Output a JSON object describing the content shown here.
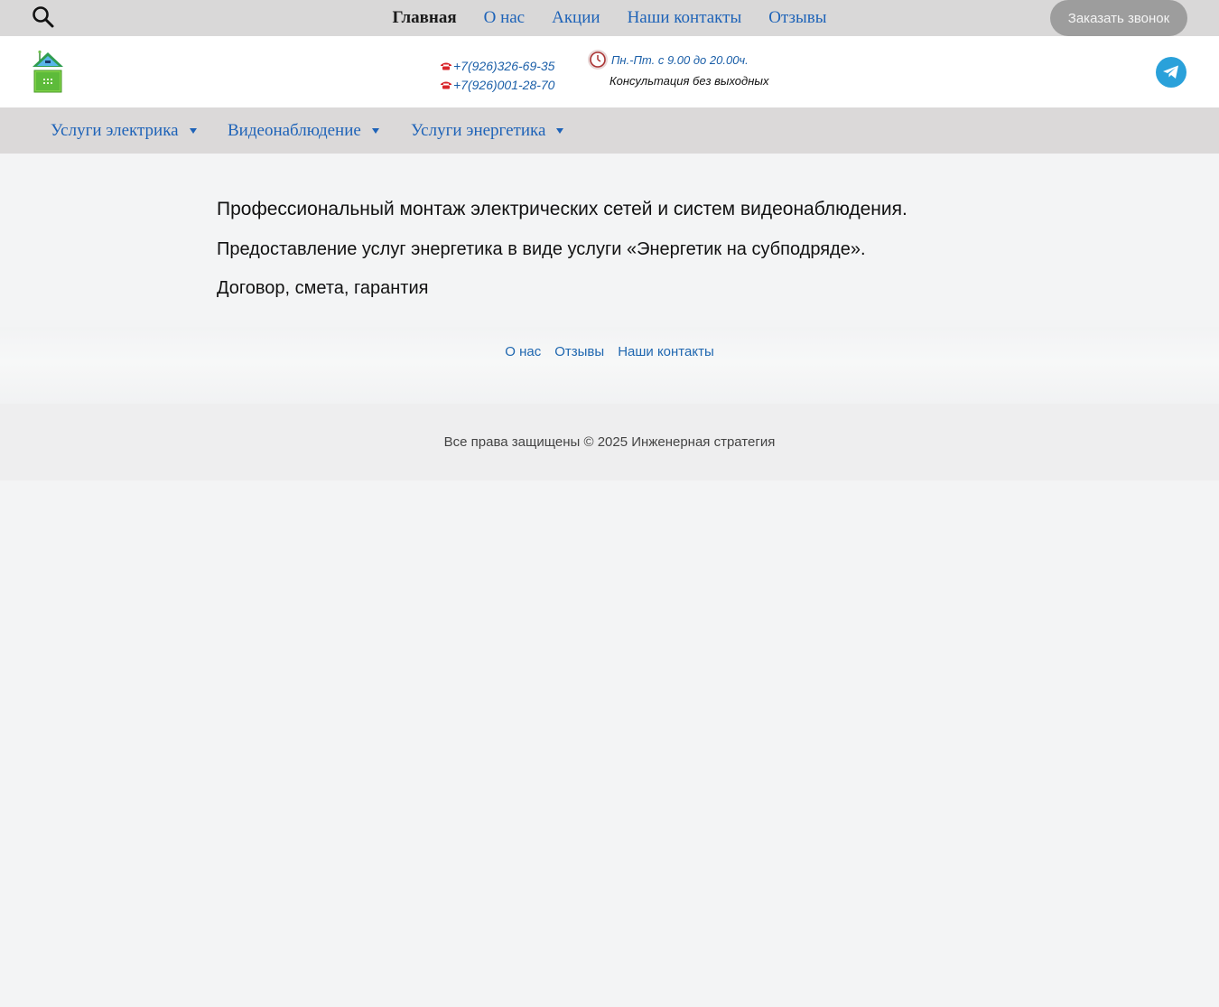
{
  "top_bar": {
    "nav": [
      "Главная",
      "О нас",
      "Акции",
      "Наши контакты",
      "Отзывы"
    ],
    "active_index": 0,
    "call_button_label": "Заказать звонок"
  },
  "header": {
    "phones": [
      "+7(926)326-69-35",
      "+7(926)001-28-70"
    ],
    "hours": "Пн.-Пт. с 9.00 до 20.00ч.",
    "consultation": "Консультация без выходных"
  },
  "services_nav": {
    "items": [
      "Услуги электрика",
      "Видеонаблюдение",
      "Услуги энергетика"
    ]
  },
  "main": {
    "paragraphs": [
      "Профессиональный монтаж электрических сетей и систем видеонаблюдения.",
      "Предоставление услуг энергетика в виде услуги «Энергетик на субподряде».",
      "Договор, смета, гарантия"
    ]
  },
  "footer": {
    "links": [
      "О нас",
      "Отзывы",
      "Наши контакты"
    ],
    "copyright": "Все права защищены © 2025 Инженерная стратегия"
  },
  "colors": {
    "link_blue": "#1e63b8",
    "telegram_blue": "#2aa1da",
    "call_button_gray": "#9d9d9d"
  },
  "icons": [
    "search-icon",
    "logo-house-icon",
    "phone-icon",
    "clock-icon",
    "telegram-icon",
    "chevron-down-icon"
  ]
}
